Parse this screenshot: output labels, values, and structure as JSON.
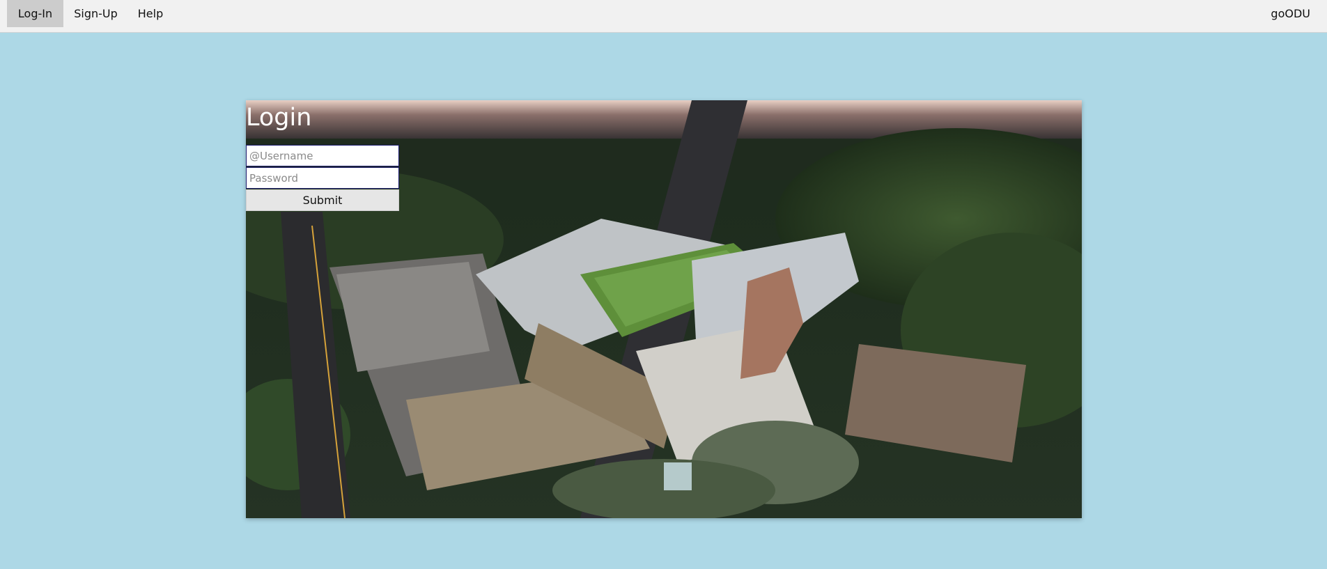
{
  "nav": {
    "login": "Log-In",
    "signup": "Sign-Up",
    "help": "Help",
    "brand": "goODU"
  },
  "login": {
    "title": "Login",
    "username_placeholder": "@Username",
    "password_placeholder": "Password",
    "submit_label": "Submit"
  },
  "colors": {
    "page_background": "#add8e6",
    "nav_background": "#f1f1f1",
    "nav_active": "#cccccc"
  }
}
